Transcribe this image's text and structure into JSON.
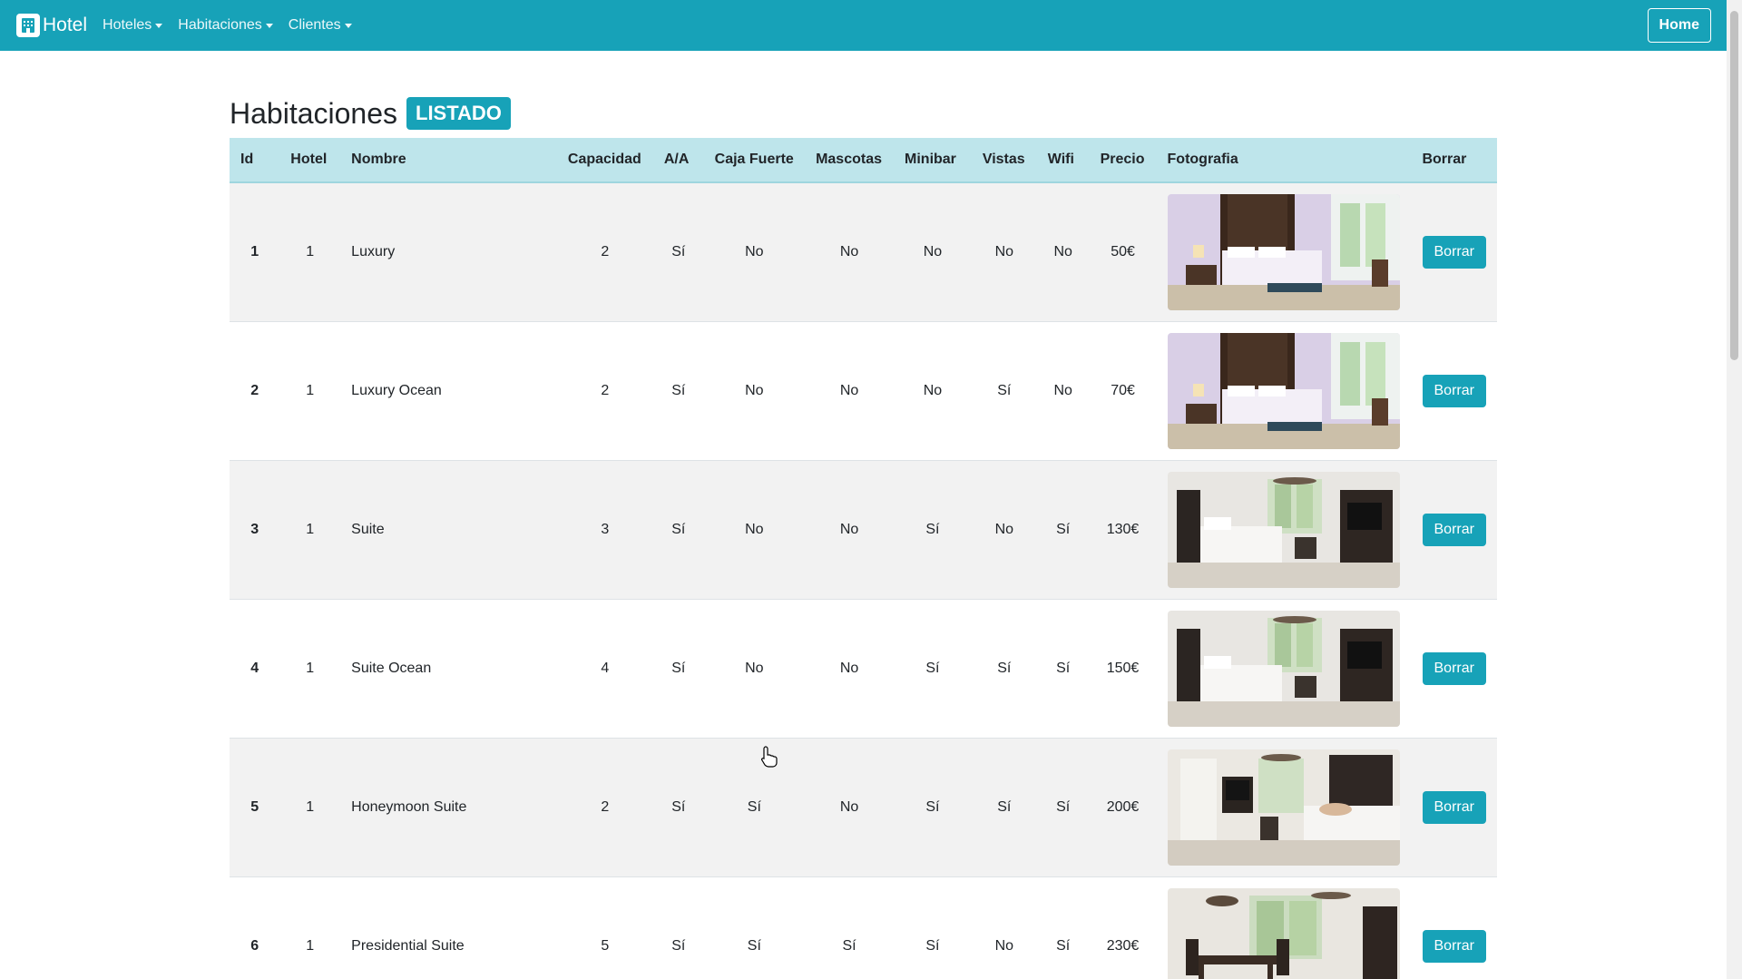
{
  "nav": {
    "brand": "Hotel",
    "menus": [
      "Hoteles",
      "Habitaciones",
      "Clientes"
    ],
    "home": "Home"
  },
  "page": {
    "title": "Habitaciones",
    "badge": "LISTADO"
  },
  "table": {
    "headers": [
      "Id",
      "Hotel",
      "Nombre",
      "Capacidad",
      "A/A",
      "Caja Fuerte",
      "Mascotas",
      "Minibar",
      "Vistas",
      "Wifi",
      "Precio",
      "Fotografia",
      "Borrar"
    ],
    "rows": [
      {
        "id": "1",
        "hotel": "1",
        "nombre": "Luxury",
        "capacidad": "2",
        "aa": "Sí",
        "caja": "No",
        "mascotas": "No",
        "minibar": "No",
        "vistas": "No",
        "wifi": "No",
        "precio": "50€",
        "photo": "bedroom-canopy",
        "borrar": "Borrar"
      },
      {
        "id": "2",
        "hotel": "1",
        "nombre": "Luxury Ocean",
        "capacidad": "2",
        "aa": "Sí",
        "caja": "No",
        "mascotas": "No",
        "minibar": "No",
        "vistas": "Sí",
        "wifi": "No",
        "precio": "70€",
        "photo": "bedroom-canopy",
        "borrar": "Borrar"
      },
      {
        "id": "3",
        "hotel": "1",
        "nombre": "Suite",
        "capacidad": "3",
        "aa": "Sí",
        "caja": "No",
        "mascotas": "No",
        "minibar": "Sí",
        "vistas": "No",
        "wifi": "Sí",
        "precio": "130€",
        "photo": "bedroom-suite",
        "borrar": "Borrar"
      },
      {
        "id": "4",
        "hotel": "1",
        "nombre": "Suite Ocean",
        "capacidad": "4",
        "aa": "Sí",
        "caja": "No",
        "mascotas": "No",
        "minibar": "Sí",
        "vistas": "Sí",
        "wifi": "Sí",
        "precio": "150€",
        "photo": "bedroom-suite",
        "borrar": "Borrar"
      },
      {
        "id": "5",
        "hotel": "1",
        "nombre": "Honeymoon Suite",
        "capacidad": "2",
        "aa": "Sí",
        "caja": "Sí",
        "mascotas": "No",
        "minibar": "Sí",
        "vistas": "Sí",
        "wifi": "Sí",
        "precio": "200€",
        "photo": "bedroom-honeymoon",
        "borrar": "Borrar"
      },
      {
        "id": "6",
        "hotel": "1",
        "nombre": "Presidential Suite",
        "capacidad": "5",
        "aa": "Sí",
        "caja": "Sí",
        "mascotas": "Sí",
        "minibar": "Sí",
        "vistas": "No",
        "wifi": "Sí",
        "precio": "230€",
        "photo": "dining-room",
        "borrar": "Borrar"
      }
    ]
  },
  "colors": {
    "primary": "#17a2b8",
    "header_bg": "#bee5eb",
    "row_striped": "#f2f2f2"
  }
}
